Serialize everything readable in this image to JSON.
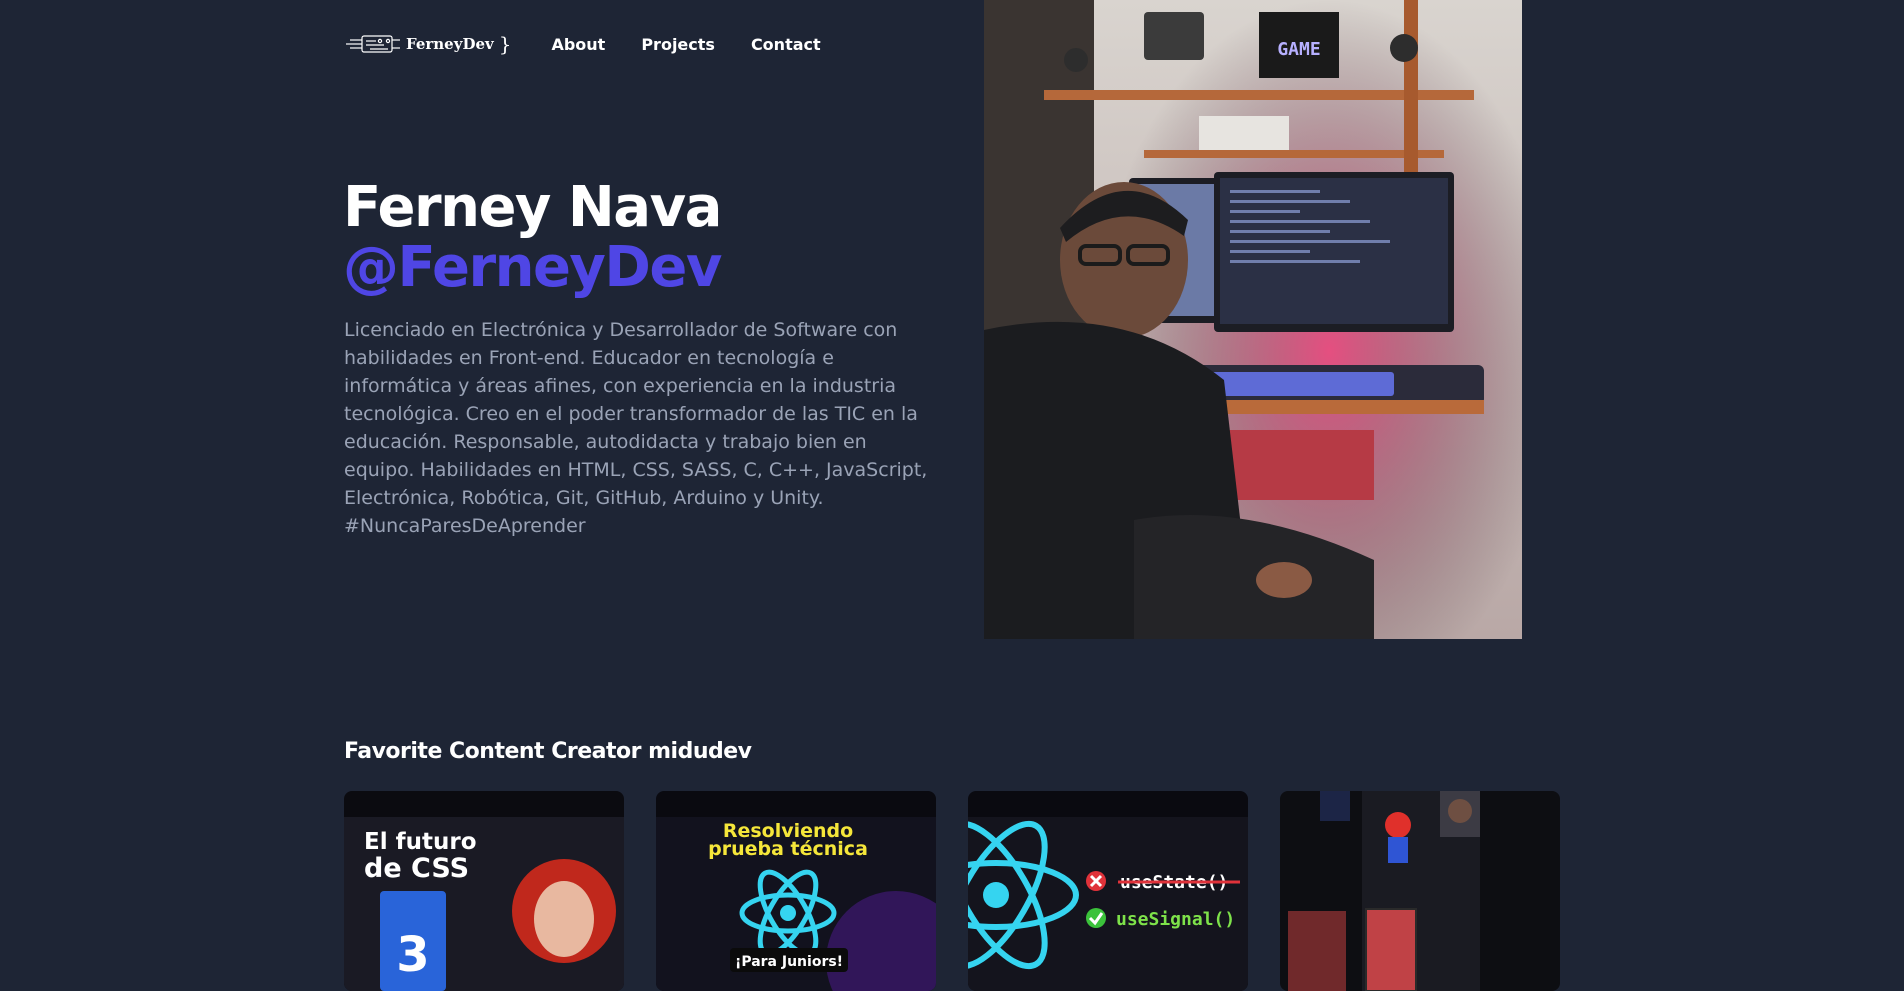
{
  "header": {
    "logo_text": "FerneyDev",
    "logo_brace": "}",
    "nav": [
      {
        "label": "About"
      },
      {
        "label": "Projects"
      },
      {
        "label": "Contact"
      }
    ]
  },
  "hero": {
    "name": "Ferney Nava",
    "handle": "@FerneyDev",
    "description": "Licenciado en Electrónica y Desarrollador de Software con habilidades en Front-end. Educador en tecnología e informática y áreas afines, con experiencia en la industria tecnológica. Creo en el poder transformador de las TIC en la educación. Responsable, autodidacta y trabajo bien en equipo. Habilidades en HTML, CSS, SASS, C, C++, JavaScript, Electrónica, Robótica, Git, GitHub, Arduino y Unity. #NuncaParesDeAprender",
    "photo_icon": "profile-photo",
    "monitor_text": "GAME"
  },
  "favorites": {
    "title": "Favorite Content Creator midudev",
    "cards": [
      {
        "line1": "El futuro",
        "line2": "de CSS",
        "badge": "3"
      },
      {
        "line1": "Resolviendo",
        "line2": "prueba técnica",
        "tag": "¡Para Juniors!"
      },
      {
        "item1": "useState()",
        "item2": "useSignal()"
      },
      {
        "thumb_icon": "game-thumbnail"
      }
    ]
  },
  "colors": {
    "background": "#1e2535",
    "accent": "#4f46e5",
    "muted_text": "#9aa3b6"
  }
}
